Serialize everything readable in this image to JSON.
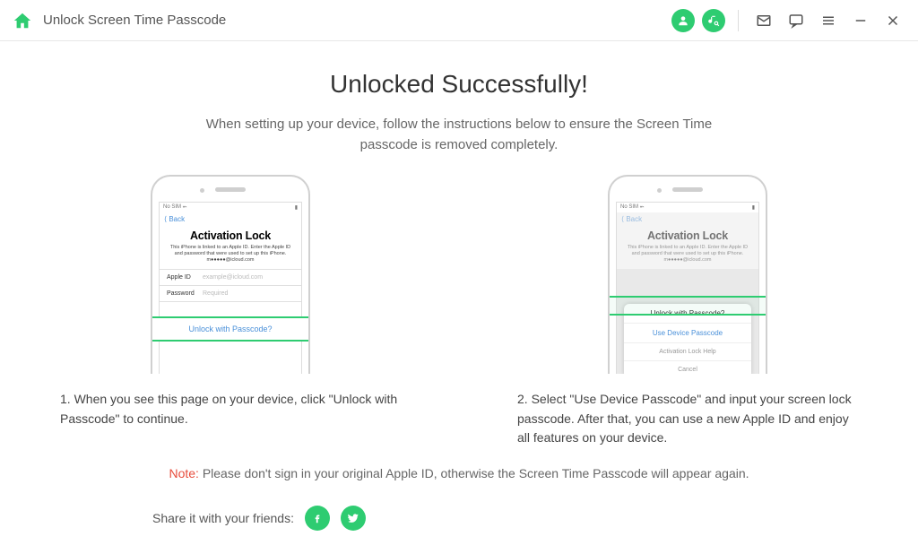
{
  "titlebar": {
    "title": "Unlock Screen Time Passcode"
  },
  "heading": "Unlocked Successfully!",
  "subheading": "When setting up your device, follow the instructions below to ensure the Screen Time passcode is removed completely.",
  "phone1": {
    "statusbar_left": "No SIM ⬶",
    "back": "⟨ Back",
    "title": "Activation Lock",
    "desc": "This iPhone is linked to an Apple ID. Enter the Apple ID and password that were used to set up this iPhone. m●●●●●@icloud.com",
    "field1_label": "Apple ID",
    "field1_val": "example@icloud.com",
    "field2_label": "Password",
    "field2_val": "Required",
    "highlight": "Unlock with Passcode?"
  },
  "phone2": {
    "statusbar_left": "No SIM ⬶",
    "back": "⟨ Back",
    "title": "Activation Lock",
    "desc": "This iPhone is linked to an Apple ID. Enter the Apple ID and password that were used to set up this iPhone. m●●●●●@icloud.com",
    "sheet_row1": "Unlock with Passcode?",
    "sheet_row2": "Use Device Passcode",
    "sheet_row3": "Activation Lock Help",
    "sheet_row4": "Cancel"
  },
  "steps": {
    "step1": "1. When you see this page on your device, click \"Unlock with Passcode\" to continue.",
    "step2": "2. Select \"Use Device Passcode\" and input your screen lock passcode. After that, you can use a new Apple ID and enjoy all features on your device."
  },
  "note": {
    "label": "Note:",
    "text": " Please don't sign in your original Apple ID, otherwise the Screen Time Passcode will appear again."
  },
  "share": {
    "text": "Share it with your friends:"
  }
}
